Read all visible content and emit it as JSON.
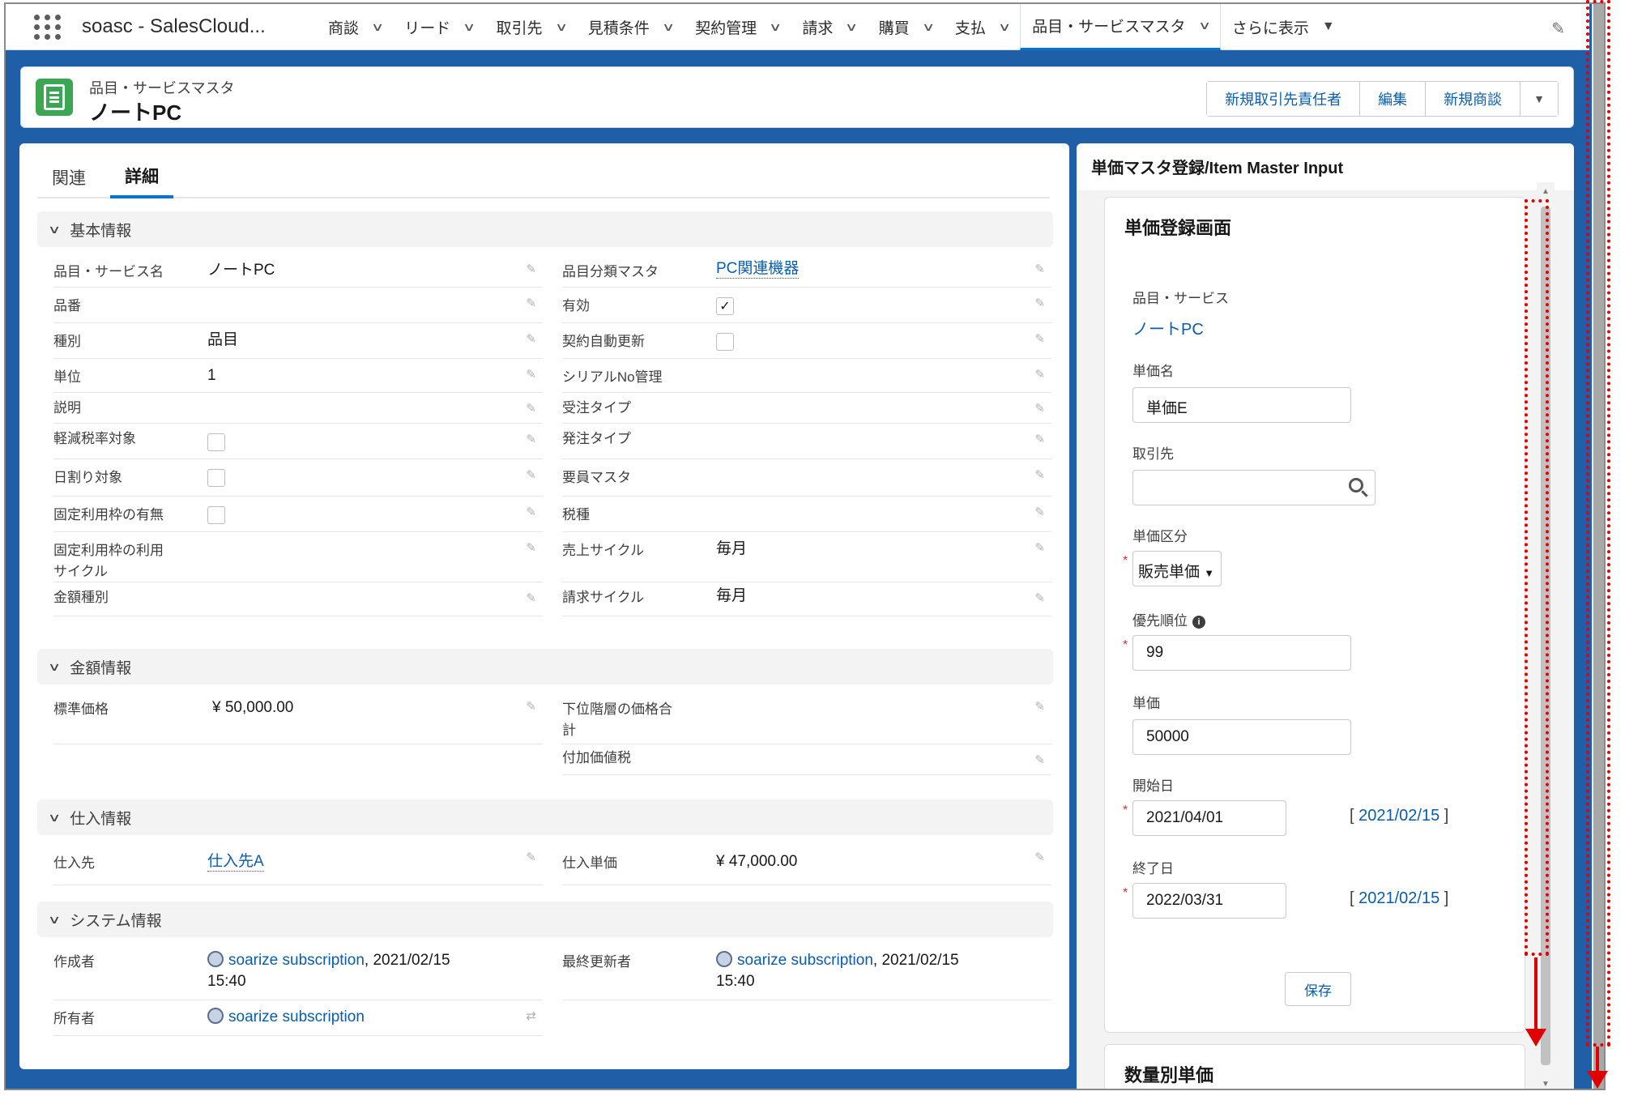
{
  "nav": {
    "app_name": "soasc - SalesCloud...",
    "items": [
      {
        "label": "商談"
      },
      {
        "label": "リード"
      },
      {
        "label": "取引先"
      },
      {
        "label": "見積条件"
      },
      {
        "label": "契約管理"
      },
      {
        "label": "請求"
      },
      {
        "label": "購買"
      },
      {
        "label": "支払"
      },
      {
        "label": "品目・サービスマスタ"
      }
    ],
    "more_label": "さらに表示"
  },
  "header": {
    "record_type": "品目・サービスマスタ",
    "title": "ノートPC",
    "actions": [
      "新規取引先責任者",
      "編集",
      "新規商談"
    ]
  },
  "detail": {
    "tabs": [
      "関連",
      "詳細"
    ],
    "active_tab": "詳細",
    "sections": {
      "basic": "基本情報",
      "amount": "金額情報",
      "purchase": "仕入情報",
      "system": "システム情報"
    },
    "basic_left": [
      {
        "label": "品目・サービス名",
        "value": "ノートPC"
      },
      {
        "label": "品番",
        "value": ""
      },
      {
        "label": "種別",
        "value": "品目"
      },
      {
        "label": "単位",
        "value": "1"
      },
      {
        "label": "説明",
        "value": ""
      },
      {
        "label": "軽減税率対象",
        "checked": false
      },
      {
        "label": "日割り対象",
        "checked": false
      },
      {
        "label": "固定利用枠の有無",
        "checked": false
      },
      {
        "label": "固定利用枠の利用サイクル",
        "value": ""
      },
      {
        "label": "金額種別",
        "value": ""
      }
    ],
    "basic_right": [
      {
        "label": "品目分類マスタ",
        "value": "PC関連機器"
      },
      {
        "label": "有効",
        "checked": true
      },
      {
        "label": "契約自動更新",
        "checked": false
      },
      {
        "label": "シリアルNo管理",
        "value": ""
      },
      {
        "label": "受注タイプ",
        "value": ""
      },
      {
        "label": "発注タイプ",
        "value": ""
      },
      {
        "label": "要員マスタ",
        "value": ""
      },
      {
        "label": "税種",
        "value": ""
      },
      {
        "label": "売上サイクル",
        "value": "毎月"
      },
      {
        "label": "請求サイクル",
        "value": "毎月"
      }
    ],
    "amount_left": [
      {
        "label": "標準価格",
        "value": "¥ 50,000.00"
      }
    ],
    "amount_right": [
      {
        "label": "下位階層の価格合計",
        "value": ""
      },
      {
        "label": "付加価値税",
        "value": ""
      }
    ],
    "purchase_left": [
      {
        "label": "仕入先",
        "value": "仕入先A"
      }
    ],
    "purchase_right": [
      {
        "label": "仕入単価",
        "value": "¥ 47,000.00"
      }
    ],
    "system": {
      "created_label": "作成者",
      "created_user": "soarize subscription",
      "created_date": ", 2021/02/15",
      "created_time": "15:40",
      "modified_label": "最終更新者",
      "modified_user": "soarize subscription",
      "modified_date": ", 2021/02/15",
      "modified_time": "15:40",
      "owner_label": "所有者",
      "owner_user": "soarize subscription"
    }
  },
  "side": {
    "title": "単価マスタ登録/Item Master Input",
    "card_title": "単価登録画面",
    "item_label": "品目・サービス",
    "item_value": "ノートPC",
    "price_name_label": "単価名",
    "price_name_value": "単価E",
    "account_label": "取引先",
    "account_value": "",
    "price_type_label": "単価区分",
    "price_type_value": "販売単価",
    "priority_label": "優先順位",
    "priority_value": "99",
    "unit_price_label": "単価",
    "unit_price_value": "50000",
    "start_label": "開始日",
    "start_value": "2021/04/01",
    "start_today": "2021/02/15",
    "end_label": "終了日",
    "end_value": "2022/03/31",
    "end_today": "2021/02/15",
    "save_label": "保存",
    "qty_card_title": "数量別単価"
  },
  "colors": {
    "brand_blue": "#1f5fa8",
    "link": "#0b5cab",
    "annotation": "#e00000",
    "record_icon": "#3ba755"
  }
}
